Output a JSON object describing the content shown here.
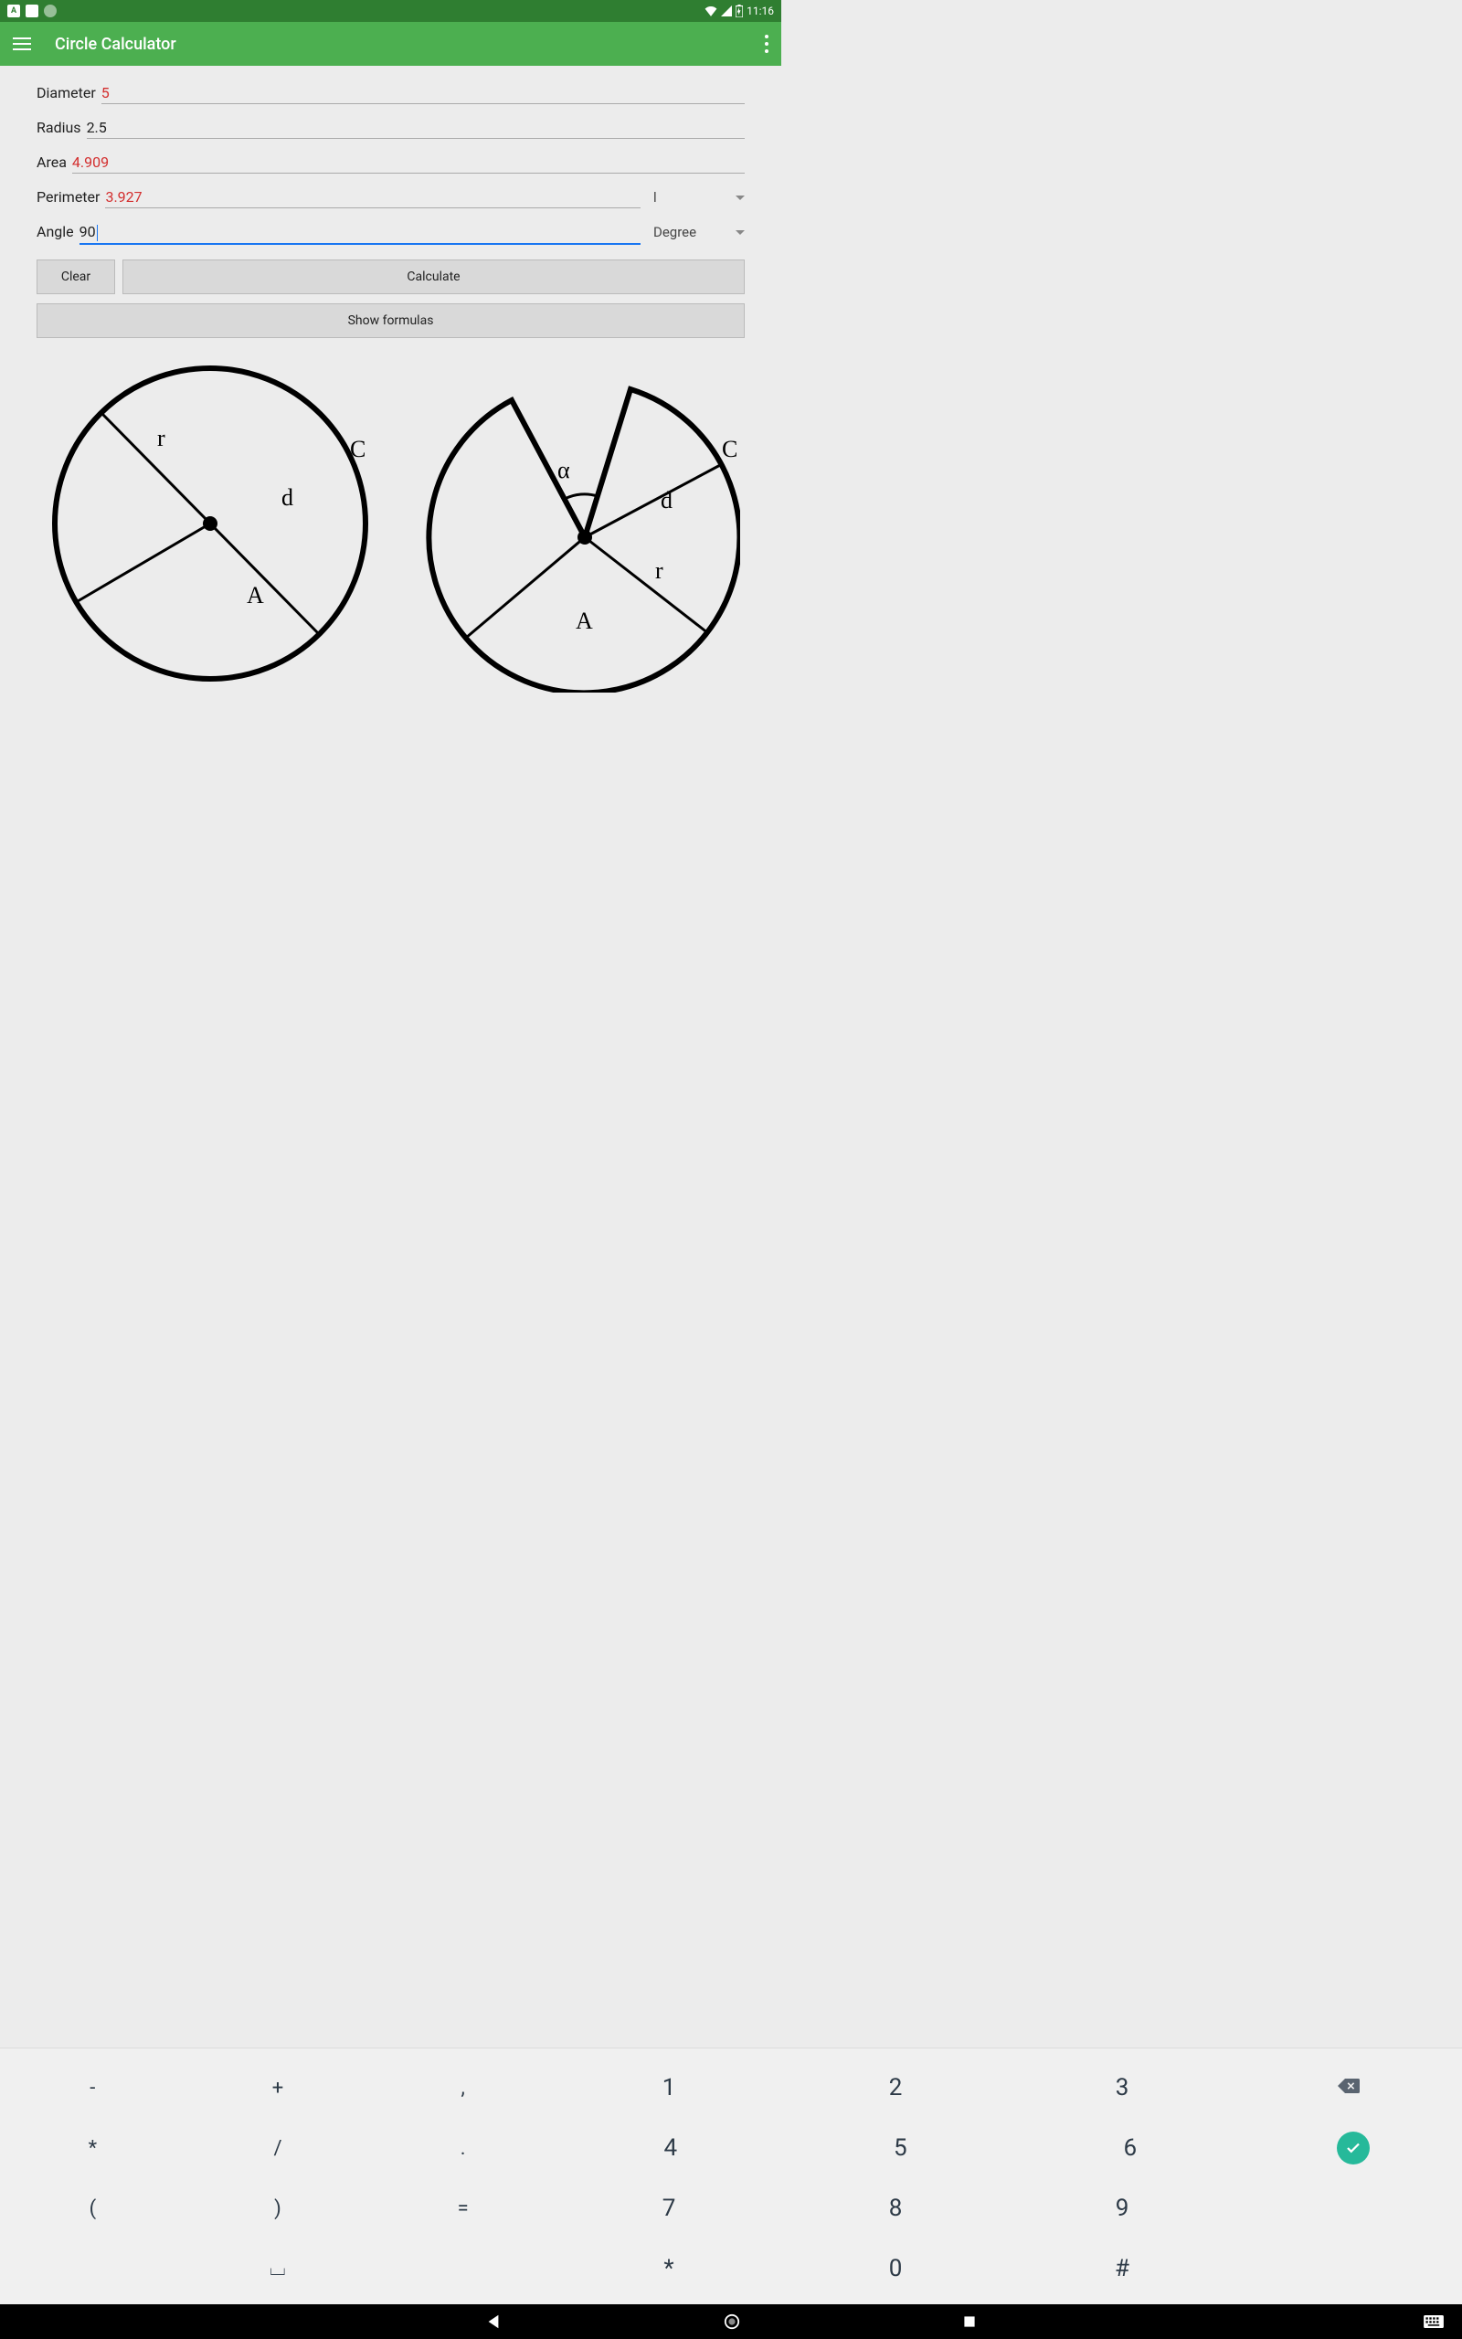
{
  "status": {
    "time": "11:16"
  },
  "appbar": {
    "title": "Circle Calculator"
  },
  "fields": {
    "diameter": {
      "label": "Diameter",
      "value": "5",
      "red": true
    },
    "radius": {
      "label": "Radius",
      "value": "2.5",
      "red": false
    },
    "area": {
      "label": "Area",
      "value": "4.909",
      "red": true
    },
    "perimeter": {
      "label": "Perimeter",
      "value": "3.927",
      "red": true,
      "unit": "l"
    },
    "angle": {
      "label": "Angle",
      "value": "90",
      "red": false,
      "unit": "Degree",
      "focused": true
    }
  },
  "buttons": {
    "clear": "Clear",
    "calculate": "Calculate",
    "show_formulas": "Show formulas"
  },
  "diagram_labels": {
    "r": "r",
    "d": "d",
    "C": "C",
    "A": "A",
    "alpha": "α"
  },
  "keyboard": {
    "row1_left": [
      "-",
      "+",
      ","
    ],
    "row1_right": [
      "1",
      "2",
      "3"
    ],
    "row2_left": [
      "*",
      "/",
      "."
    ],
    "row2_right": [
      "4",
      "5",
      "6"
    ],
    "row3_left": [
      "(",
      ")",
      "="
    ],
    "row3_right": [
      "7",
      "8",
      "9"
    ],
    "row4_left": [
      "",
      "⌴",
      ""
    ],
    "row4_right": [
      "*",
      "0",
      "#"
    ]
  }
}
